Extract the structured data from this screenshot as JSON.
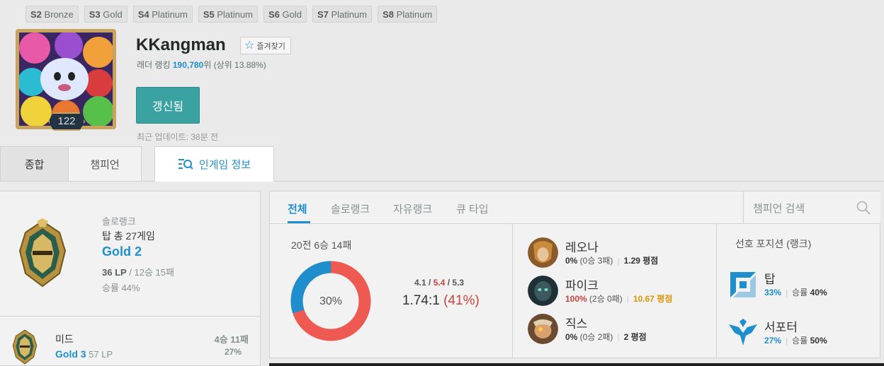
{
  "seasons": [
    {
      "season": "S2",
      "tier": "Bronze"
    },
    {
      "season": "S3",
      "tier": "Gold"
    },
    {
      "season": "S4",
      "tier": "Platinum"
    },
    {
      "season": "S5",
      "tier": "Platinum"
    },
    {
      "season": "S6",
      "tier": "Gold"
    },
    {
      "season": "S7",
      "tier": "Platinum"
    },
    {
      "season": "S8",
      "tier": "Platinum"
    }
  ],
  "profile": {
    "level": "122",
    "name": "KKangman",
    "favorite_label": "즐겨찾기",
    "ladder_prefix": "래더 랭킹 ",
    "ladder_rank": "190,780",
    "ladder_suffix": "위 (상위 13.88%)",
    "renew_label": "갱신됨",
    "last_update": "최근 업데이트: 38분 전"
  },
  "tabs": [
    "종합",
    "챔피언",
    "인게임 정보"
  ],
  "rank": {
    "type": "솔로랭크",
    "position_games": "탑 총 27게임",
    "tier": "Gold 2",
    "lp": "36 LP",
    "record": " / 12승 15패",
    "winrate": "승률 44%"
  },
  "sub_rank": {
    "position": "미드",
    "tier": "Gold 3",
    "lp": " 57 LP",
    "record": "4승 11패",
    "winrate": "27%"
  },
  "filters": {
    "tabs": [
      "전체",
      "솔로랭크",
      "자유랭크",
      "큐 타입"
    ],
    "search_placeholder": "챔피언 검색"
  },
  "summary": {
    "record": "20전 6승 14패",
    "win_ratio": 0.3,
    "win_pct_label": "30%",
    "kda_k": "4.1",
    "kda_d": "5.4",
    "kda_a": "5.3",
    "kda_ratio": "1.74:1",
    "kda_pct": "(41%)"
  },
  "champions": [
    {
      "name": "레오나",
      "winrate": "0%",
      "games": " (0승 3패)",
      "kda": "1.29 평점",
      "winrate_style": "normal",
      "kda_style": "normal",
      "icon": "leona-portrait"
    },
    {
      "name": "파이크",
      "winrate": "100%",
      "games": " (2승 0패)",
      "kda": "10.67 평점",
      "winrate_style": "red",
      "kda_style": "orange",
      "icon": "pyke-portrait"
    },
    {
      "name": "직스",
      "winrate": "0%",
      "games": " (0승 2패)",
      "kda": "2 평점",
      "winrate_style": "normal",
      "kda_style": "normal",
      "icon": "ziggs-portrait"
    }
  ],
  "positions": {
    "title": "선호 포지션 (랭크)",
    "items": [
      {
        "name": "탑",
        "share": "33%",
        "winrate_label": "승률",
        "winrate": "40%",
        "icon": "top-lane-icon"
      },
      {
        "name": "서포터",
        "share": "27%",
        "winrate_label": "승률",
        "winrate": "50%",
        "icon": "support-lane-icon"
      }
    ]
  },
  "colors": {
    "accent": "#1f8ecd",
    "loss": "#ee5a52",
    "win": "#1f8ecd",
    "renew": "#3aa3a1"
  }
}
